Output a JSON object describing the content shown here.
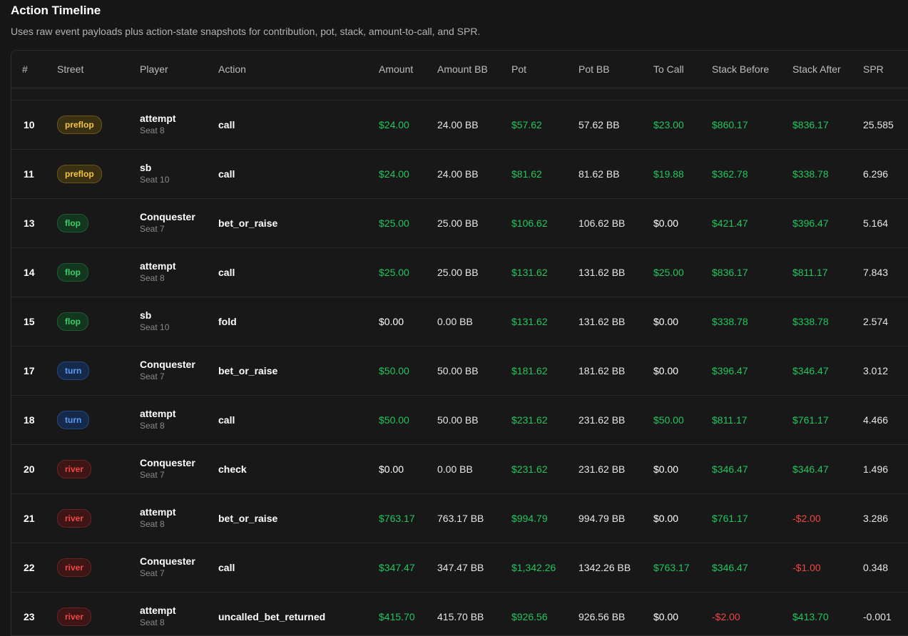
{
  "header": {
    "title": "Action Timeline",
    "subtitle": "Uses raw event payloads plus action-state snapshots for contribution, pot, stack, amount-to-call, and SPR."
  },
  "columns": [
    "#",
    "Street",
    "Player",
    "Action",
    "Amount",
    "Amount BB",
    "Pot",
    "Pot BB",
    "To Call",
    "Stack Before",
    "Stack After",
    "SPR"
  ],
  "rows": [
    {
      "num": "10",
      "street": "preflop",
      "player": "attempt",
      "seat": "Seat 8",
      "action": "call",
      "amount": "$24.00",
      "amount_bb": "24.00 BB",
      "pot": "$57.62",
      "pot_bb": "57.62 BB",
      "to_call": "$23.00",
      "stack_before": "$860.17",
      "stack_after": "$836.17",
      "spr": "25.585"
    },
    {
      "num": "11",
      "street": "preflop",
      "player": "sb",
      "seat": "Seat 10",
      "action": "call",
      "amount": "$24.00",
      "amount_bb": "24.00 BB",
      "pot": "$81.62",
      "pot_bb": "81.62 BB",
      "to_call": "$19.88",
      "stack_before": "$362.78",
      "stack_after": "$338.78",
      "spr": "6.296"
    },
    {
      "num": "13",
      "street": "flop",
      "player": "Conquester",
      "seat": "Seat 7",
      "action": "bet_or_raise",
      "amount": "$25.00",
      "amount_bb": "25.00 BB",
      "pot": "$106.62",
      "pot_bb": "106.62 BB",
      "to_call": "$0.00",
      "stack_before": "$421.47",
      "stack_after": "$396.47",
      "spr": "5.164"
    },
    {
      "num": "14",
      "street": "flop",
      "player": "attempt",
      "seat": "Seat 8",
      "action": "call",
      "amount": "$25.00",
      "amount_bb": "25.00 BB",
      "pot": "$131.62",
      "pot_bb": "131.62 BB",
      "to_call": "$25.00",
      "stack_before": "$836.17",
      "stack_after": "$811.17",
      "spr": "7.843"
    },
    {
      "num": "15",
      "street": "flop",
      "player": "sb",
      "seat": "Seat 10",
      "action": "fold",
      "amount": "$0.00",
      "amount_bb": "0.00 BB",
      "pot": "$131.62",
      "pot_bb": "131.62 BB",
      "to_call": "$0.00",
      "stack_before": "$338.78",
      "stack_after": "$338.78",
      "spr": "2.574"
    },
    {
      "num": "17",
      "street": "turn",
      "player": "Conquester",
      "seat": "Seat 7",
      "action": "bet_or_raise",
      "amount": "$50.00",
      "amount_bb": "50.00 BB",
      "pot": "$181.62",
      "pot_bb": "181.62 BB",
      "to_call": "$0.00",
      "stack_before": "$396.47",
      "stack_after": "$346.47",
      "spr": "3.012"
    },
    {
      "num": "18",
      "street": "turn",
      "player": "attempt",
      "seat": "Seat 8",
      "action": "call",
      "amount": "$50.00",
      "amount_bb": "50.00 BB",
      "pot": "$231.62",
      "pot_bb": "231.62 BB",
      "to_call": "$50.00",
      "stack_before": "$811.17",
      "stack_after": "$761.17",
      "spr": "4.466"
    },
    {
      "num": "20",
      "street": "river",
      "player": "Conquester",
      "seat": "Seat 7",
      "action": "check",
      "amount": "$0.00",
      "amount_bb": "0.00 BB",
      "pot": "$231.62",
      "pot_bb": "231.62 BB",
      "to_call": "$0.00",
      "stack_before": "$346.47",
      "stack_after": "$346.47",
      "spr": "1.496"
    },
    {
      "num": "21",
      "street": "river",
      "player": "attempt",
      "seat": "Seat 8",
      "action": "bet_or_raise",
      "amount": "$763.17",
      "amount_bb": "763.17 BB",
      "pot": "$994.79",
      "pot_bb": "994.79 BB",
      "to_call": "$0.00",
      "stack_before": "$761.17",
      "stack_after": "-$2.00",
      "spr": "3.286"
    },
    {
      "num": "22",
      "street": "river",
      "player": "Conquester",
      "seat": "Seat 7",
      "action": "call",
      "amount": "$347.47",
      "amount_bb": "347.47 BB",
      "pot": "$1,342.26",
      "pot_bb": "1342.26 BB",
      "to_call": "$763.17",
      "stack_before": "$346.47",
      "stack_after": "-$1.00",
      "spr": "0.348"
    },
    {
      "num": "23",
      "street": "river",
      "player": "attempt",
      "seat": "Seat 8",
      "action": "uncalled_bet_returned",
      "amount": "$415.70",
      "amount_bb": "415.70 BB",
      "pot": "$926.56",
      "pot_bb": "926.56 BB",
      "to_call": "$0.00",
      "stack_before": "-$2.00",
      "stack_after": "$413.70",
      "spr": "-0.001"
    }
  ],
  "colors": {
    "positive": "#22c55e",
    "negative": "#ef4444",
    "preflop": "#f5c542",
    "flop": "#3ecf6a",
    "turn": "#5b9bf5",
    "river": "#f04848"
  }
}
